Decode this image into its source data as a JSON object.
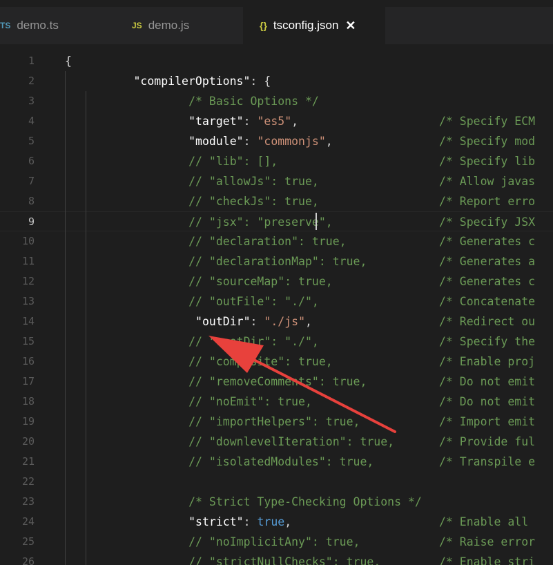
{
  "tabs": [
    {
      "icon": "TS",
      "label": "demo.ts",
      "active": false,
      "icon_color": "#519aba"
    },
    {
      "icon": "JS",
      "label": "demo.js",
      "active": false,
      "icon_color": "#cbcb41"
    },
    {
      "icon": "{}",
      "label": "tsconfig.json",
      "active": true,
      "icon_color": "#cbcb41",
      "close": "✕"
    }
  ],
  "editor": {
    "current_line": 9,
    "lines": [
      {
        "n": "1",
        "indent": 4,
        "tokens": [
          {
            "t": "{",
            "c": "p"
          }
        ],
        "comment": ""
      },
      {
        "n": "2",
        "indent": 14,
        "tokens": [
          {
            "t": "\"compilerOptions\"",
            "c": "w"
          },
          {
            "t": ": {",
            "c": "p"
          }
        ],
        "comment": ""
      },
      {
        "n": "3",
        "indent": 22,
        "tokens": [
          {
            "t": "/* Basic Options */",
            "c": "c"
          }
        ],
        "comment": ""
      },
      {
        "n": "4",
        "indent": 22,
        "tokens": [
          {
            "t": "\"target\"",
            "c": "w"
          },
          {
            "t": ": ",
            "c": "p"
          },
          {
            "t": "\"es5\"",
            "c": "s"
          },
          {
            "t": ",",
            "c": "p"
          }
        ],
        "comment": "/* Specify ECM"
      },
      {
        "n": "5",
        "indent": 22,
        "tokens": [
          {
            "t": "\"module\"",
            "c": "w"
          },
          {
            "t": ": ",
            "c": "p"
          },
          {
            "t": "\"commonjs\"",
            "c": "s"
          },
          {
            "t": ",",
            "c": "p"
          }
        ],
        "comment": "/* Specify mod"
      },
      {
        "n": "6",
        "indent": 22,
        "tokens": [
          {
            "t": "// \"lib\": [],",
            "c": "c"
          }
        ],
        "comment": "/* Specify lib"
      },
      {
        "n": "7",
        "indent": 22,
        "tokens": [
          {
            "t": "// \"allowJs\": true,",
            "c": "c"
          }
        ],
        "comment": "/* Allow javas"
      },
      {
        "n": "8",
        "indent": 22,
        "tokens": [
          {
            "t": "// \"checkJs\": true,",
            "c": "c"
          }
        ],
        "comment": "/* Report erro"
      },
      {
        "n": "9",
        "indent": 22,
        "tokens": [
          {
            "t": "// \"jsx\": \"preserve\",",
            "c": "c"
          }
        ],
        "comment": "/* Specify JSX"
      },
      {
        "n": "10",
        "indent": 22,
        "tokens": [
          {
            "t": "// \"declaration\": true,",
            "c": "c"
          }
        ],
        "comment": "/* Generates c"
      },
      {
        "n": "11",
        "indent": 22,
        "tokens": [
          {
            "t": "// \"declarationMap\": true,",
            "c": "c"
          }
        ],
        "comment": "/* Generates a"
      },
      {
        "n": "12",
        "indent": 22,
        "tokens": [
          {
            "t": "// \"sourceMap\": true,",
            "c": "c"
          }
        ],
        "comment": "/* Generates c"
      },
      {
        "n": "13",
        "indent": 22,
        "tokens": [
          {
            "t": "// \"outFile\": \"./\",",
            "c": "c"
          }
        ],
        "comment": "/* Concatenate"
      },
      {
        "n": "14",
        "indent": 23,
        "tokens": [
          {
            "t": "\"outDir\"",
            "c": "w"
          },
          {
            "t": ": ",
            "c": "p"
          },
          {
            "t": "\"./js\"",
            "c": "s"
          },
          {
            "t": ",",
            "c": "p"
          }
        ],
        "comment": "/* Redirect ou"
      },
      {
        "n": "15",
        "indent": 22,
        "tokens": [
          {
            "t": "// \"rootDir\": \"./\",",
            "c": "c"
          }
        ],
        "comment": "/* Specify the"
      },
      {
        "n": "16",
        "indent": 22,
        "tokens": [
          {
            "t": "// \"composite\": true,",
            "c": "c"
          }
        ],
        "comment": "/* Enable proj"
      },
      {
        "n": "17",
        "indent": 22,
        "tokens": [
          {
            "t": "// \"removeComments\": true,",
            "c": "c"
          }
        ],
        "comment": "/* Do not emit"
      },
      {
        "n": "18",
        "indent": 22,
        "tokens": [
          {
            "t": "// \"noEmit\": true,",
            "c": "c"
          }
        ],
        "comment": "/* Do not emit"
      },
      {
        "n": "19",
        "indent": 22,
        "tokens": [
          {
            "t": "// \"importHelpers\": true,",
            "c": "c"
          }
        ],
        "comment": "/* Import emit"
      },
      {
        "n": "20",
        "indent": 22,
        "tokens": [
          {
            "t": "// \"downlevelIteration\": true,",
            "c": "c"
          }
        ],
        "comment": "/* Provide ful"
      },
      {
        "n": "21",
        "indent": 22,
        "tokens": [
          {
            "t": "// \"isolatedModules\": true,",
            "c": "c"
          }
        ],
        "comment": "/* Transpile e"
      },
      {
        "n": "22",
        "indent": 22,
        "tokens": [],
        "comment": ""
      },
      {
        "n": "23",
        "indent": 22,
        "tokens": [
          {
            "t": "/* Strict Type-Checking Options */",
            "c": "c"
          }
        ],
        "comment": ""
      },
      {
        "n": "24",
        "indent": 22,
        "tokens": [
          {
            "t": "\"strict\"",
            "c": "w"
          },
          {
            "t": ": ",
            "c": "p"
          },
          {
            "t": "true",
            "c": "b"
          },
          {
            "t": ",",
            "c": "p"
          }
        ],
        "comment": "/* Enable all"
      },
      {
        "n": "25",
        "indent": 22,
        "tokens": [
          {
            "t": "// \"noImplicitAny\": true,",
            "c": "c"
          }
        ],
        "comment": "/* Raise error"
      },
      {
        "n": "26",
        "indent": 22,
        "tokens": [
          {
            "t": "// \"strictNullChecks\": true,",
            "c": "c"
          }
        ],
        "comment": "/* Enable stri"
      }
    ]
  },
  "annotation": {
    "color": "#e8413c"
  }
}
